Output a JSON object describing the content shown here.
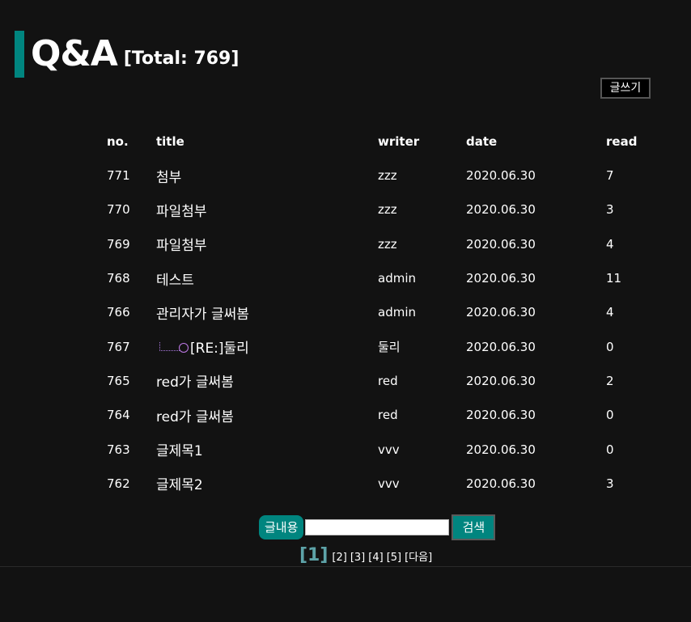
{
  "header": {
    "title": "Q&A",
    "total": "[Total: 769]"
  },
  "actions": {
    "write_label": "글쓰기"
  },
  "table": {
    "columns": [
      "no.",
      "title",
      "writer",
      "date",
      "read"
    ],
    "rows": [
      {
        "no": "771",
        "title": "첨부",
        "writer": "zzz",
        "date": "2020.06.30",
        "read": "7"
      },
      {
        "no": "770",
        "title": "파일첨부",
        "writer": "zzz",
        "date": "2020.06.30",
        "read": "3"
      },
      {
        "no": "769",
        "title": "파일첨부",
        "writer": "zzz",
        "date": "2020.06.30",
        "read": "4"
      },
      {
        "no": "768",
        "title": "테스트",
        "writer": "admin",
        "date": "2020.06.30",
        "read": "11"
      },
      {
        "no": "766",
        "title": "관리자가 글써봄",
        "writer": "admin",
        "date": "2020.06.30",
        "read": "4"
      },
      {
        "no": "767",
        "title": "[RE:]둘리",
        "writer": "둘리",
        "date": "2020.06.30",
        "read": "0"
      },
      {
        "no": "765",
        "title": "red가 글써봄",
        "writer": "red",
        "date": "2020.06.30",
        "read": "2"
      },
      {
        "no": "764",
        "title": "red가 글써봄",
        "writer": "red",
        "date": "2020.06.30",
        "read": "0"
      },
      {
        "no": "763",
        "title": "글제목1",
        "writer": "vvv",
        "date": "2020.06.30",
        "read": "0"
      },
      {
        "no": "762",
        "title": "글제목2",
        "writer": "vvv",
        "date": "2020.06.30",
        "read": "3"
      }
    ]
  },
  "search": {
    "field_label": "글내용",
    "input_value": "",
    "button_label": "검색"
  },
  "pagination": {
    "current": "[1]",
    "pages": [
      "[2]",
      "[3]",
      "[4]",
      "[5]"
    ],
    "next_label": "[다음]"
  },
  "colors": {
    "accent": "#00857f",
    "background": "#121212",
    "current_page": "#5da3a8"
  }
}
